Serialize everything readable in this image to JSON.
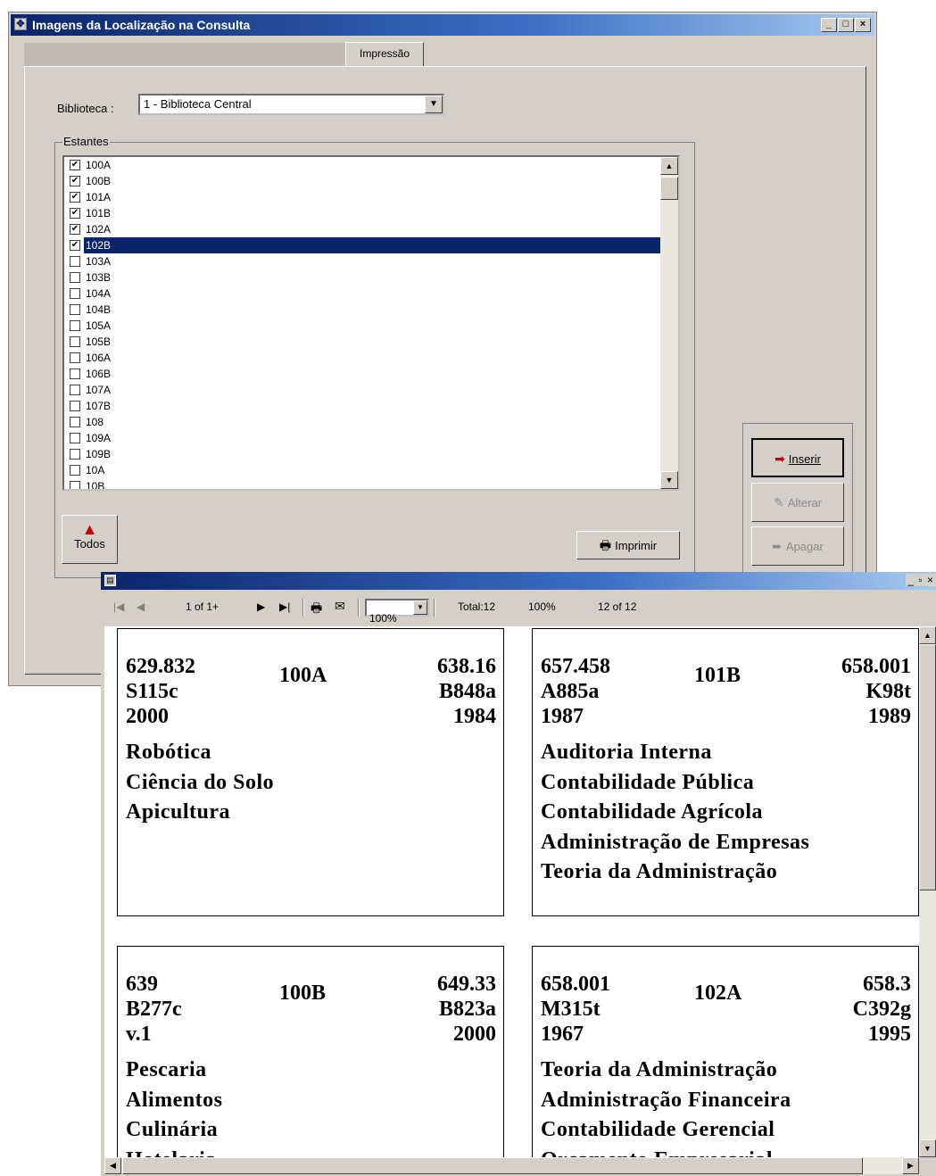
{
  "window": {
    "title": "Imagens da Localização na Consulta",
    "controls": {
      "minimize": "_",
      "maximize": "□",
      "close": "×"
    }
  },
  "tab": {
    "label": "Impressão"
  },
  "biblioteca": {
    "label": "Biblioteca :",
    "value": "1 - Biblioteca Central"
  },
  "estantes": {
    "label": "Estantes",
    "items": [
      {
        "label": "100A",
        "checked": true
      },
      {
        "label": "100B",
        "checked": true
      },
      {
        "label": "101A",
        "checked": true
      },
      {
        "label": "101B",
        "checked": true
      },
      {
        "label": "102A",
        "checked": true
      },
      {
        "label": "102B",
        "checked": true,
        "selected": true
      },
      {
        "label": "103A",
        "checked": false
      },
      {
        "label": "103B",
        "checked": false
      },
      {
        "label": "104A",
        "checked": false
      },
      {
        "label": "104B",
        "checked": false
      },
      {
        "label": "105A",
        "checked": false
      },
      {
        "label": "105B",
        "checked": false
      },
      {
        "label": "106A",
        "checked": false
      },
      {
        "label": "106B",
        "checked": false
      },
      {
        "label": "107A",
        "checked": false
      },
      {
        "label": "107B",
        "checked": false
      },
      {
        "label": "108",
        "checked": false
      },
      {
        "label": "109A",
        "checked": false
      },
      {
        "label": "109B",
        "checked": false
      },
      {
        "label": "10A",
        "checked": false
      },
      {
        "label": "10B",
        "checked": false
      }
    ]
  },
  "buttons": {
    "todos": "Todos",
    "imprimir": "Imprimir",
    "inserir": "Inserir",
    "alterar": "Alterar",
    "apagar": "Apagar"
  },
  "preview": {
    "toolbar": {
      "page": "1 of 1+",
      "zoom": "100%",
      "total": "Total:12",
      "percent": "100%",
      "records": "12 of 12"
    },
    "window_controls": "_ ▫ ×",
    "cards": [
      {
        "left": [
          "629.832",
          "S115c",
          "2000"
        ],
        "shelf": "100A",
        "right": [
          "638.16",
          "B848a",
          "1984"
        ],
        "subjects": [
          "Robótica",
          "Ciência do Solo",
          "Apicultura"
        ]
      },
      {
        "left": [
          "657.458",
          "A885a",
          "1987"
        ],
        "shelf": "101B",
        "right": [
          "658.001",
          "K98t",
          "1989"
        ],
        "subjects": [
          "Auditoria Interna",
          "Contabilidade Pública",
          "Contabilidade Agrícola",
          "Administração de Empresas",
          "Teoria da Administração"
        ]
      },
      {
        "left": [
          "639",
          "B277c",
          "v.1"
        ],
        "shelf": "100B",
        "right": [
          "649.33",
          "B823a",
          "2000"
        ],
        "subjects": [
          "Pescaria",
          "Alimentos",
          "Culinária",
          "Hotelaria"
        ]
      },
      {
        "left": [
          "658.001",
          "M315t",
          "1967"
        ],
        "shelf": "102A",
        "right": [
          "658.3",
          "C392g",
          "1995"
        ],
        "subjects": [
          "Teoria da Administração",
          "Administração Financeira",
          "Contabilidade Gerencial",
          "Orçamento Empresarial"
        ]
      }
    ]
  }
}
